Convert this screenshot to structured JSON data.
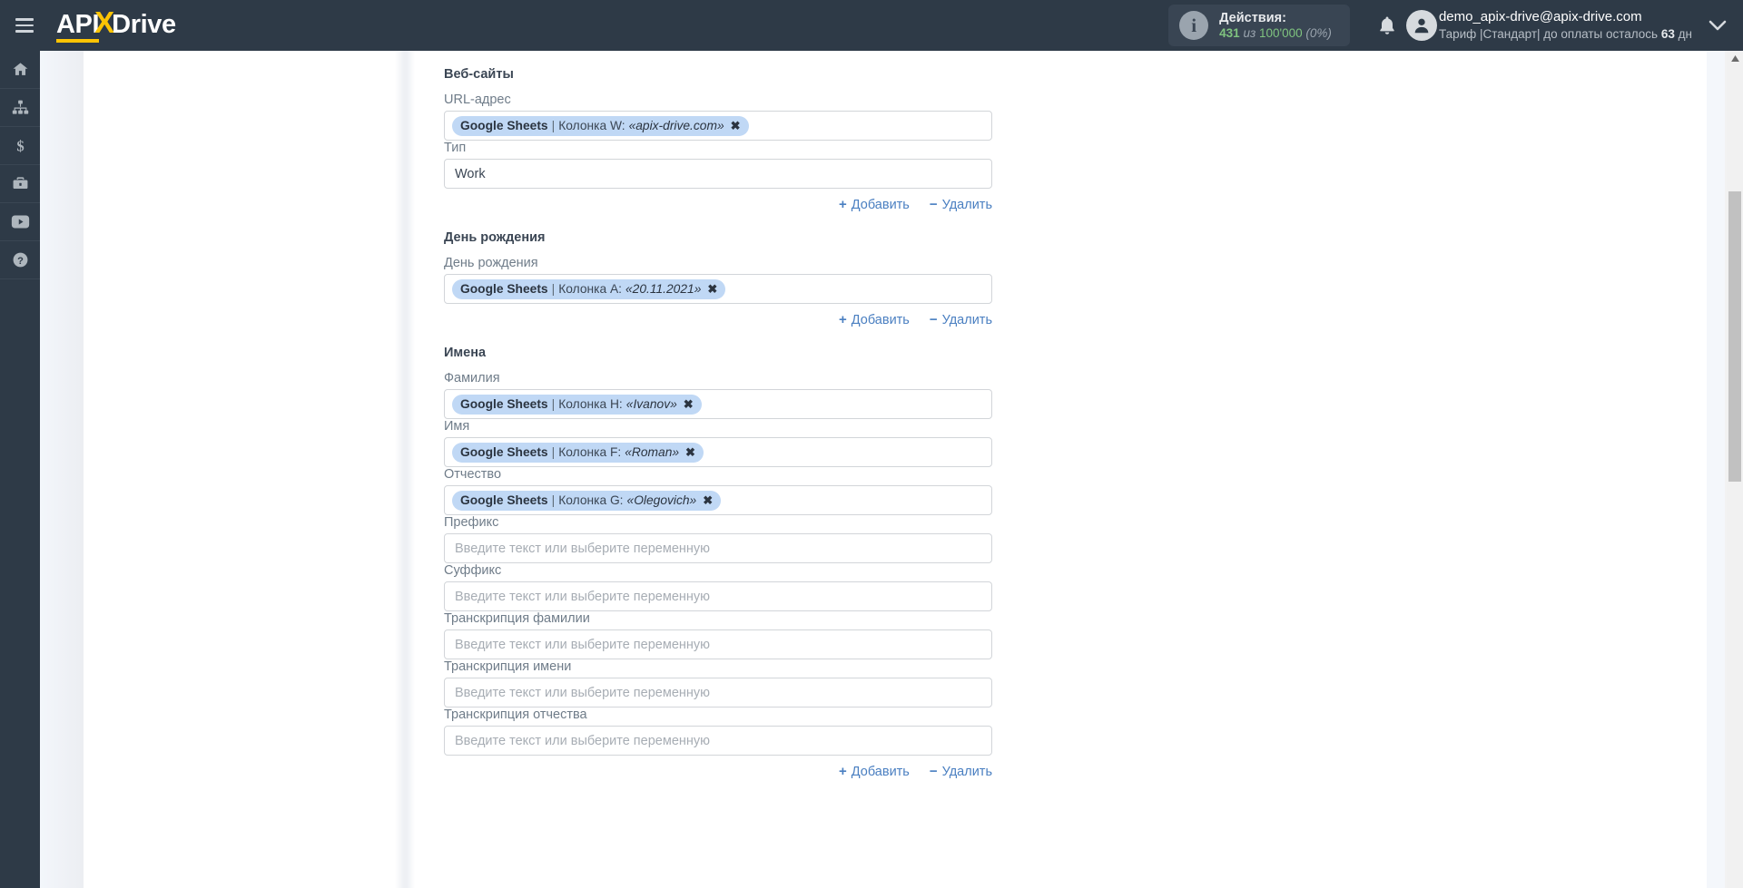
{
  "header": {
    "logo": {
      "part1": "API",
      "part2": "X",
      "part3": "Drive"
    },
    "menu_icon": "hamburger-icon",
    "actions": {
      "title": "Действия:",
      "used": "431",
      "of_word": "из",
      "total": "100'000",
      "percent": "(0%)"
    },
    "notifications_icon": "bell-icon",
    "user": {
      "email": "demo_apix-drive@apix-drive.com",
      "plan_prefix": "Тариф |Стандарт| до оплаты осталось",
      "plan_days": "63",
      "plan_suffix": "дн"
    },
    "caret_icon": "chevron-down-icon"
  },
  "sidebar": {
    "items": [
      {
        "icon": "home-icon",
        "name": "sidebar-item-home"
      },
      {
        "icon": "connections-icon",
        "name": "sidebar-item-connections"
      },
      {
        "icon": "dollar-icon",
        "name": "sidebar-item-billing"
      },
      {
        "icon": "briefcase-icon",
        "name": "sidebar-item-business"
      },
      {
        "icon": "youtube-icon",
        "name": "sidebar-item-video"
      },
      {
        "icon": "help-icon",
        "name": "sidebar-item-help"
      }
    ]
  },
  "form": {
    "placeholder": "Введите текст или выберите переменную",
    "add_label": "Добавить",
    "remove_label": "Удалить",
    "add_sign": "+",
    "remove_sign": "−",
    "sections": [
      {
        "title": "Веб-сайты",
        "fields": [
          {
            "label": "URL-адрес",
            "type": "chip",
            "chip": {
              "source": "Google Sheets",
              "column": "Колонка W:",
              "value": "«apix-drive.com»"
            }
          },
          {
            "label": "Тип",
            "type": "text",
            "value": "Work"
          }
        ]
      },
      {
        "title": "День рождения",
        "fields": [
          {
            "label": "День рождения",
            "type": "chip",
            "chip": {
              "source": "Google Sheets",
              "column": "Колонка A:",
              "value": "«20.11.2021»"
            }
          }
        ]
      },
      {
        "title": "Имена",
        "fields": [
          {
            "label": "Фамилия",
            "type": "chip",
            "chip": {
              "source": "Google Sheets",
              "column": "Колонка H:",
              "value": "«Ivanov»"
            }
          },
          {
            "label": "Имя",
            "type": "chip",
            "chip": {
              "source": "Google Sheets",
              "column": "Колонка F:",
              "value": "«Roman»"
            }
          },
          {
            "label": "Отчество",
            "type": "chip",
            "chip": {
              "source": "Google Sheets",
              "column": "Колонка G:",
              "value": "«Olegovich»"
            }
          },
          {
            "label": "Префикс",
            "type": "empty"
          },
          {
            "label": "Суффикс",
            "type": "empty"
          },
          {
            "label": "Транскрипция фамилии",
            "type": "empty"
          },
          {
            "label": "Транскрипция имени",
            "type": "empty"
          },
          {
            "label": "Транскрипция отчества",
            "type": "empty"
          }
        ]
      }
    ]
  },
  "colors": {
    "topbar": "#2e3a47",
    "accent_yellow": "#fdc404",
    "link_blue": "#4a7fc1",
    "chip_blue": "#c0d8f5",
    "counter_green": "#7fc37f"
  }
}
